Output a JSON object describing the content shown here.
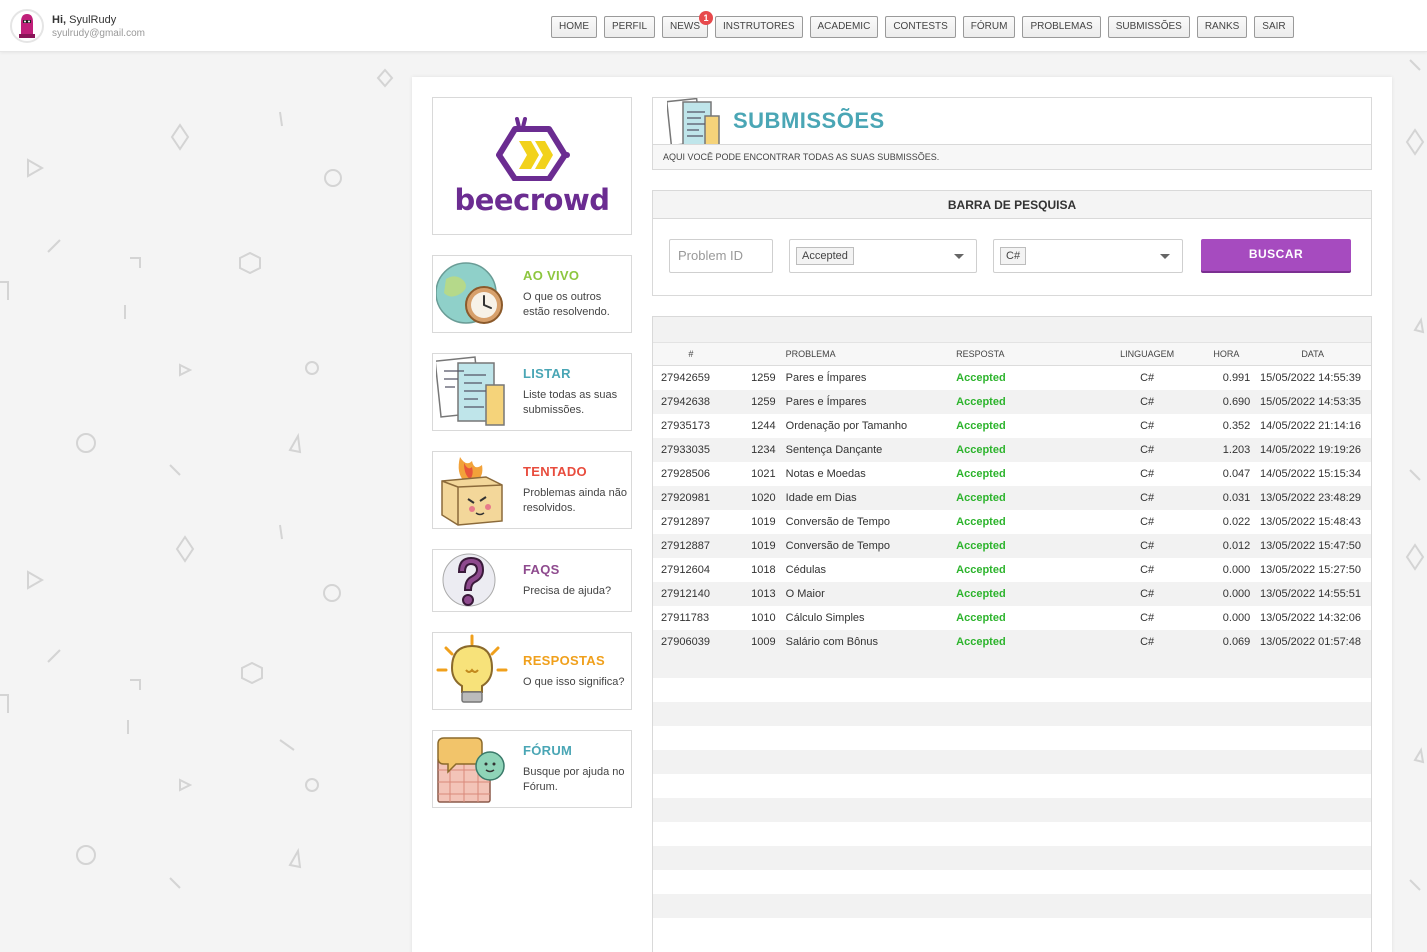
{
  "user": {
    "greeting_prefix": "Hi,",
    "name": "SyulRudy",
    "email": "syulrudy@gmail.com"
  },
  "nav": [
    {
      "label": "HOME"
    },
    {
      "label": "PERFIL"
    },
    {
      "label": "NEWS",
      "badge": "1"
    },
    {
      "label": "INSTRUTORES"
    },
    {
      "label": "ACADEMIC"
    },
    {
      "label": "CONTESTS"
    },
    {
      "label": "FÓRUM"
    },
    {
      "label": "PROBLEMAS"
    },
    {
      "label": "SUBMISSÕES"
    },
    {
      "label": "RANKS"
    },
    {
      "label": "SAIR"
    }
  ],
  "logo": {
    "text": "beecrowd"
  },
  "sidebar": [
    {
      "title": "AO VIVO",
      "desc": "O que os outros estão resolvendo.",
      "color": "#8dc63f",
      "icon": "globe-clock-icon"
    },
    {
      "title": "LISTAR",
      "desc": "Liste todas as suas submissões.",
      "color": "#4aa6b5",
      "icon": "documents-icon"
    },
    {
      "title": "TENTADO",
      "desc": "Problemas ainda não resolvidos.",
      "color": "#e84c3d",
      "icon": "burning-box-icon"
    },
    {
      "title": "FAQS",
      "desc": "Precisa de ajuda?",
      "color": "#8e4a8e",
      "icon": "question-mark-icon"
    },
    {
      "title": "RESPOSTAS",
      "desc": "O que isso significa?",
      "color": "#f0a01c",
      "icon": "light-bulb-icon"
    },
    {
      "title": "FÓRUM",
      "desc": "Busque por ajuda no Fórum.",
      "color": "#4aa6b5",
      "icon": "chat-bubbles-icon"
    }
  ],
  "header": {
    "title": "SUBMISSÕES",
    "subtitle": "AQUI VOCÊ PODE ENCONTRAR TODAS AS SUAS SUBMISSÕES."
  },
  "search": {
    "title": "BARRA DE PESQUISA",
    "problem_placeholder": "Problem ID",
    "response_value": "Accepted",
    "language_value": "C#",
    "button_label": "BUSCAR"
  },
  "table": {
    "columns": [
      "#",
      "",
      "PROBLEMA",
      "RESPOSTA",
      "LINGUAGEM",
      "HORA",
      "DATA"
    ],
    "rows": [
      [
        "27942659",
        "1259",
        "Pares e Ímpares",
        "Accepted",
        "C#",
        "0.991",
        "15/05/2022 14:55:39"
      ],
      [
        "27942638",
        "1259",
        "Pares e Ímpares",
        "Accepted",
        "C#",
        "0.690",
        "15/05/2022 14:53:35"
      ],
      [
        "27935173",
        "1244",
        "Ordenação por Tamanho",
        "Accepted",
        "C#",
        "0.352",
        "14/05/2022 21:14:16"
      ],
      [
        "27933035",
        "1234",
        "Sentença Dançante",
        "Accepted",
        "C#",
        "1.203",
        "14/05/2022 19:19:26"
      ],
      [
        "27928506",
        "1021",
        "Notas e Moedas",
        "Accepted",
        "C#",
        "0.047",
        "14/05/2022 15:15:34"
      ],
      [
        "27920981",
        "1020",
        "Idade em Dias",
        "Accepted",
        "C#",
        "0.031",
        "13/05/2022 23:48:29"
      ],
      [
        "27912897",
        "1019",
        "Conversão de Tempo",
        "Accepted",
        "C#",
        "0.022",
        "13/05/2022 15:48:43"
      ],
      [
        "27912887",
        "1019",
        "Conversão de Tempo",
        "Accepted",
        "C#",
        "0.012",
        "13/05/2022 15:47:50"
      ],
      [
        "27912604",
        "1018",
        "Cédulas",
        "Accepted",
        "C#",
        "0.000",
        "13/05/2022 15:27:50"
      ],
      [
        "27912140",
        "1013",
        "O Maior",
        "Accepted",
        "C#",
        "0.000",
        "13/05/2022 14:55:51"
      ],
      [
        "27911783",
        "1010",
        "Cálculo Simples",
        "Accepted",
        "C#",
        "0.000",
        "13/05/2022 14:32:06"
      ],
      [
        "27906039",
        "1009",
        "Salário com Bônus",
        "Accepted",
        "C#",
        "0.069",
        "13/05/2022 01:57:48"
      ]
    ]
  },
  "colors": {
    "accent_purple": "#a64bbf",
    "title_teal": "#4aa6b5",
    "accepted_green": "#2db42d",
    "badge_red": "#e7494c"
  }
}
